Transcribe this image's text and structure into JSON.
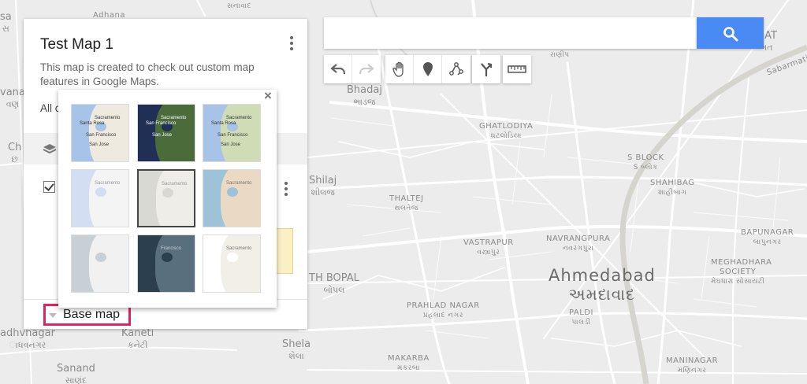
{
  "map": {
    "city": {
      "name": "Ahmedabad",
      "name_gu": "અમદાવાદ"
    },
    "places": [
      {
        "name": "Adhana",
        "gu": ""
      },
      {
        "name": "",
        "gu": "સનાવાદ"
      },
      {
        "name": "",
        "gu": "રાણીપ"
      },
      {
        "name": "GAT",
        "gu": "ગત"
      },
      {
        "name": "Bhadaj",
        "gu": "ભાડજ"
      },
      {
        "name": "GHATLODIYA",
        "gu": "ઘટલોડિયા"
      },
      {
        "name": "S BLOCK",
        "gu": "S બ્લોક"
      },
      {
        "name": "SHAHIBAG",
        "gu": "શાહીબાગ"
      },
      {
        "name": "Shilaj",
        "gu": "શીલજ"
      },
      {
        "name": "THALTEJ",
        "gu": "થલતેજ"
      },
      {
        "name": "BAPUNAGAR",
        "gu": "બાપુનગર"
      },
      {
        "name": "VASTRAPUR",
        "gu": "વસ્ત્રાપુર"
      },
      {
        "name": "NAVRANGPURA",
        "gu": "નવરંગપુરા"
      },
      {
        "name": "MEGHADHARA",
        "gu": ""
      },
      {
        "name": "SOCIETY",
        "gu": "મેઘધારા સોસાયટી"
      },
      {
        "name": "TH BOPAL",
        "gu": "બોપલ"
      },
      {
        "name": "PRAHLAD NAGAR",
        "gu": "પ્રહલાદ નગર"
      },
      {
        "name": "PALDI",
        "gu": "પાલડી"
      },
      {
        "name": "Kaneti",
        "gu": "કનેટી"
      },
      {
        "name": "Shela",
        "gu": "શેલા"
      },
      {
        "name": "MAKARBA",
        "gu": "મકરબા"
      },
      {
        "name": "MANINAGAR",
        "gu": "મણિનગર"
      },
      {
        "name": "Sanand",
        "gu": "સાણંદ"
      },
      {
        "name": "adhvnagar",
        "gu": "ાધવનગર"
      },
      {
        "name": "Sabarmati",
        "gu": ""
      },
      {
        "name": "sa",
        "gu": "સ"
      },
      {
        "name": "vana",
        "gu": "વણ"
      },
      {
        "name": "Ch",
        "gu": "છ"
      }
    ]
  },
  "panel": {
    "title": "Test Map 1",
    "description": "This map is created to check out custom map features in Google Maps.",
    "all_items": "All c",
    "base_map_label": "Base map"
  },
  "popup": {
    "close": "×",
    "thumbs": [
      {
        "name": "map",
        "labels": [
          "Sacramento",
          "Santa Rosa",
          "San Francisco",
          "San Jose"
        ],
        "water": "#a8c3e8",
        "land": "#eeeae0",
        "bay": "#a8c3e8",
        "text": "#333333"
      },
      {
        "name": "satellite",
        "labels": [
          "Sacramento",
          "San Francisco",
          "San Jose"
        ],
        "water": "#1f2f55",
        "land": "#4b6b3a",
        "bay": "#1f2f55",
        "text": "#ffffff"
      },
      {
        "name": "terrain",
        "labels": [
          "Sacramento",
          "Santa Rosa",
          "San Francisco",
          "San Jose"
        ],
        "water": "#a8c3e8",
        "land": "#cfdcb6",
        "bay": "#a8c3e8",
        "text": "#333333"
      },
      {
        "name": "light political",
        "labels": [
          "Sacramento"
        ],
        "water": "#d4def2",
        "land": "#f4f4f4",
        "bay": "#d4def2",
        "text": "#999999"
      },
      {
        "name": "mono city",
        "labels": [
          "Sacramento"
        ],
        "water": "#d9d9d4",
        "land": "#eeede8",
        "bay": "#d9d9d4",
        "text": "#999999"
      },
      {
        "name": "simple atlas",
        "labels": [
          "Sacramento"
        ],
        "water": "#9ec3d8",
        "land": "#ead9c3",
        "bay": "#9ec3d8",
        "text": "#777777"
      },
      {
        "name": "light landmass",
        "labels": [],
        "water": "#c8d0d6",
        "land": "#f1f1f1",
        "bay": "#c8d0d6",
        "text": "#999999"
      },
      {
        "name": "dark landmass",
        "labels": [
          "Francisco"
        ],
        "water": "#2b3f4e",
        "land": "#5a6f7e",
        "bay": "#2b3f4e",
        "text": "#cccccc"
      },
      {
        "name": "whitewater",
        "labels": [
          "Sacramento"
        ],
        "water": "#ffffff",
        "land": "#f2efe9",
        "bay": "#ffffff",
        "text": "#777777"
      }
    ]
  },
  "search": {
    "placeholder": "",
    "value": ""
  },
  "toolbar": {
    "tools": [
      "undo-icon",
      "redo-icon",
      "hand-icon",
      "marker-icon",
      "draw-line-icon",
      "directions-icon",
      "ruler-icon"
    ]
  },
  "colors": {
    "accent": "#4a8af4",
    "highlight": "#e0245e"
  }
}
